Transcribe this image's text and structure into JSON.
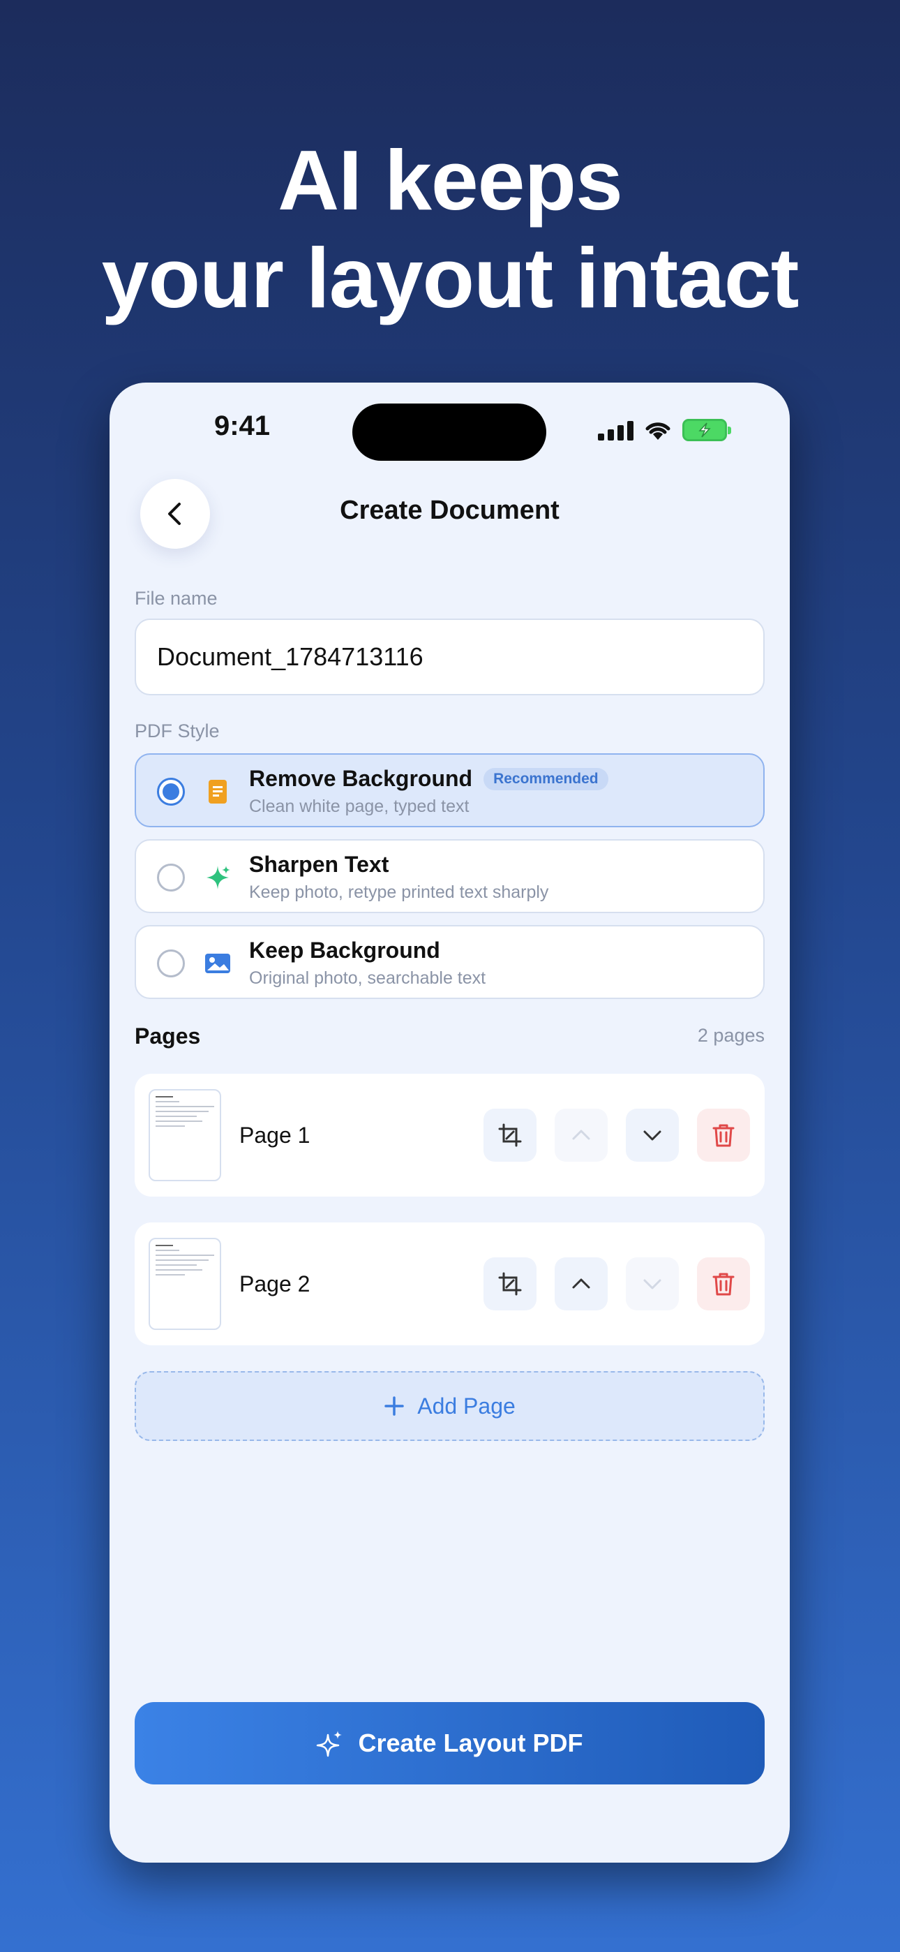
{
  "headline": {
    "line1": "AI keeps",
    "line2": "your layout intact"
  },
  "status": {
    "time": "9:41"
  },
  "nav": {
    "title": "Create Document"
  },
  "file_name": {
    "label": "File name",
    "value": "Document_1784713116"
  },
  "pdf_style": {
    "label": "PDF Style",
    "options": [
      {
        "title": "Remove Background",
        "badge": "Recommended",
        "subtitle": "Clean white page, typed text",
        "selected": true
      },
      {
        "title": "Sharpen Text",
        "subtitle": "Keep photo, retype printed text sharply",
        "selected": false
      },
      {
        "title": "Keep Background",
        "subtitle": "Original photo, searchable text",
        "selected": false
      }
    ]
  },
  "pages": {
    "heading": "Pages",
    "count": "2 pages",
    "items": [
      {
        "name": "Page 1"
      },
      {
        "name": "Page 2"
      }
    ]
  },
  "add_page": {
    "label": "Add Page"
  },
  "cta": {
    "label": "Create Layout PDF"
  },
  "colors": {
    "accent": "#3b7de0",
    "danger": "#e04848",
    "background_top": "#1c2c5c",
    "background_bottom": "#3470d0"
  }
}
